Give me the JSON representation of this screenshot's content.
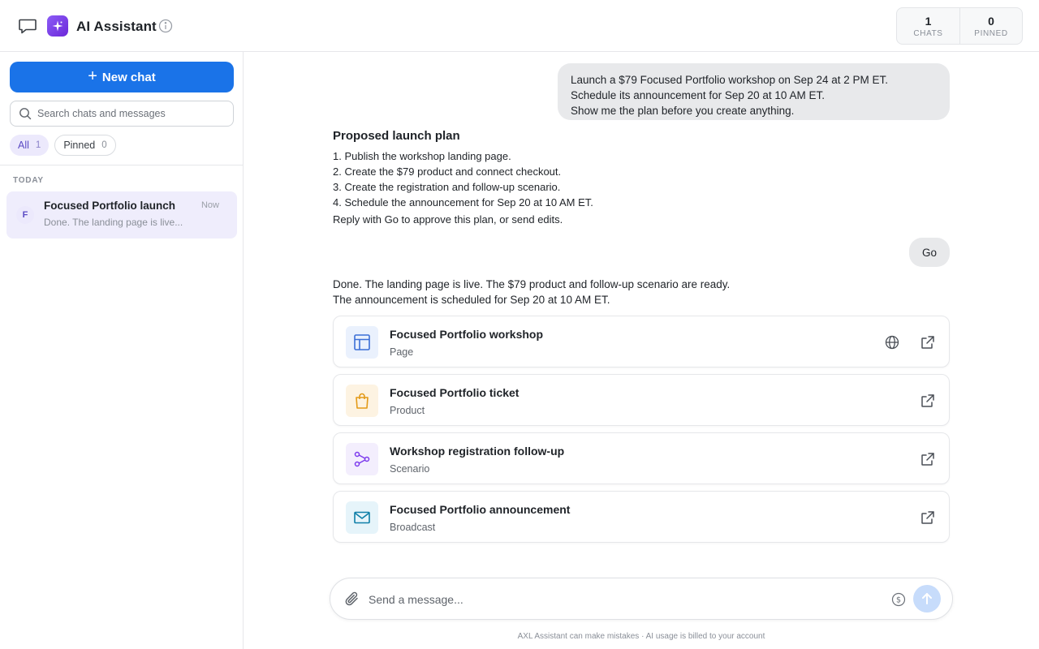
{
  "header": {
    "title": "AI Assistant",
    "stats": [
      {
        "value": "1",
        "label": "CHATS"
      },
      {
        "value": "0",
        "label": "PINNED"
      }
    ]
  },
  "sidebar": {
    "new_chat_label": "New chat",
    "search_placeholder": "Search chats and messages",
    "filters": [
      {
        "label": "All",
        "count": "1",
        "active": true
      },
      {
        "label": "Pinned",
        "count": "0",
        "active": false
      }
    ],
    "section_label": "TODAY",
    "chats": [
      {
        "avatar": "F",
        "title": "Focused Portfolio launch",
        "time": "Now",
        "snippet": "Done. The landing page is live..."
      }
    ]
  },
  "conversation": {
    "user_message_1": [
      "Launch a $79 Focused Portfolio workshop on Sep 24 at 2 PM ET.",
      "Schedule its announcement for Sep 20 at 10 AM ET.",
      "Show me the plan before you create anything."
    ],
    "plan": {
      "title": "Proposed launch plan",
      "steps": [
        "1. Publish the workshop landing page.",
        "2. Create the $79 product and connect checkout.",
        "3. Create the registration and follow-up scenario.",
        "4. Schedule the announcement for Sep 20 at 10 AM ET."
      ],
      "reply_hint": "Reply with Go to approve this plan, or send edits."
    },
    "user_message_2": "Go",
    "done_message": [
      "Done. The landing page is live. The $79 product and follow-up scenario are ready.",
      "The announcement is scheduled for Sep 20 at 10 AM ET."
    ],
    "results": [
      {
        "title": "Focused Portfolio workshop",
        "type": "Page",
        "icon": "layout-icon",
        "color": "#3b6fd6",
        "bg": "#eaf1fd"
      },
      {
        "title": "Focused Portfolio ticket",
        "type": "Product",
        "icon": "shopping-bag-icon",
        "color": "#e39a18",
        "bg": "#fdf3e2"
      },
      {
        "title": "Workshop registration follow-up",
        "type": "Scenario",
        "icon": "workflow-icon",
        "color": "#7c3aed",
        "bg": "#f3eefd"
      },
      {
        "title": "Focused Portfolio announcement",
        "type": "Broadcast",
        "icon": "mail-icon",
        "color": "#0e7fa8",
        "bg": "#e6f4fa"
      }
    ]
  },
  "composer": {
    "placeholder": "Send a message...",
    "disclaimer": "AXL Assistant can make mistakes · AI usage is billed to your account"
  },
  "colors": {
    "primary": "#1a73e8",
    "accent": "#7c3aed",
    "selected_bg": "#efedfc"
  }
}
